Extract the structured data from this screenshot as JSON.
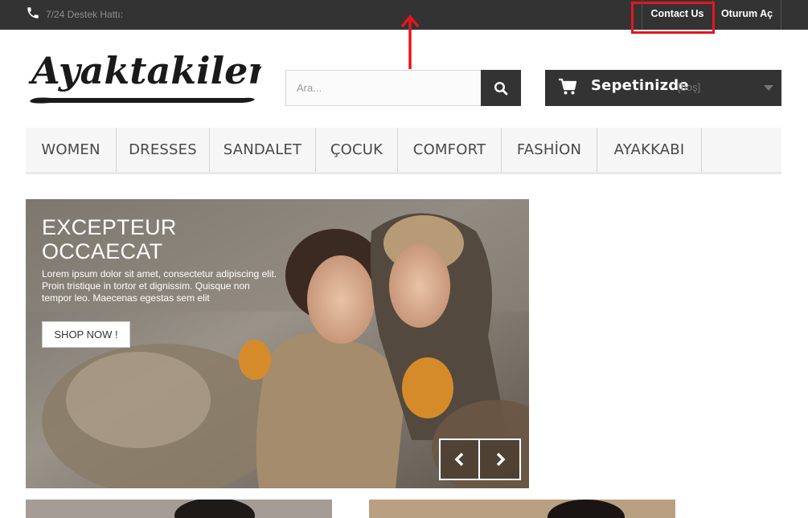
{
  "topbar": {
    "phone_icon": "phone-icon",
    "support_text": "7/24 Destek Hattı:",
    "contact_label": "Contact Us",
    "signin_label": "Oturum Aç"
  },
  "header": {
    "logo_text": "Ayaktakiler",
    "search_placeholder": "Ara...",
    "search_icon": "search-icon",
    "cart": {
      "icon": "cart-icon",
      "title": "Sepetinizde",
      "status": "[boş]"
    }
  },
  "menu": {
    "items": [
      {
        "label": "WOMEN"
      },
      {
        "label": "DRESSES"
      },
      {
        "label": "SANDALET"
      },
      {
        "label": "ÇOCUK"
      },
      {
        "label": "COMFORT"
      },
      {
        "label": "FASHİON"
      },
      {
        "label": "AYAKKABI"
      }
    ]
  },
  "slider": {
    "title_line1": "EXCEPTEUR",
    "title_line2": "OCCAECAT",
    "text": "Lorem ipsum dolor sit amet, consectetur adipiscing elit. Proin tristique in tortor et dignissim. Quisque non tempor leo. Maecenas egestas sem elit",
    "button_label": "SHOP NOW !",
    "prev_icon": "chevron-left-icon",
    "next_icon": "chevron-right-icon"
  },
  "colors": {
    "dark": "#333333",
    "highlight": "#e3161f",
    "menu_bg": "#f6f6f6"
  }
}
